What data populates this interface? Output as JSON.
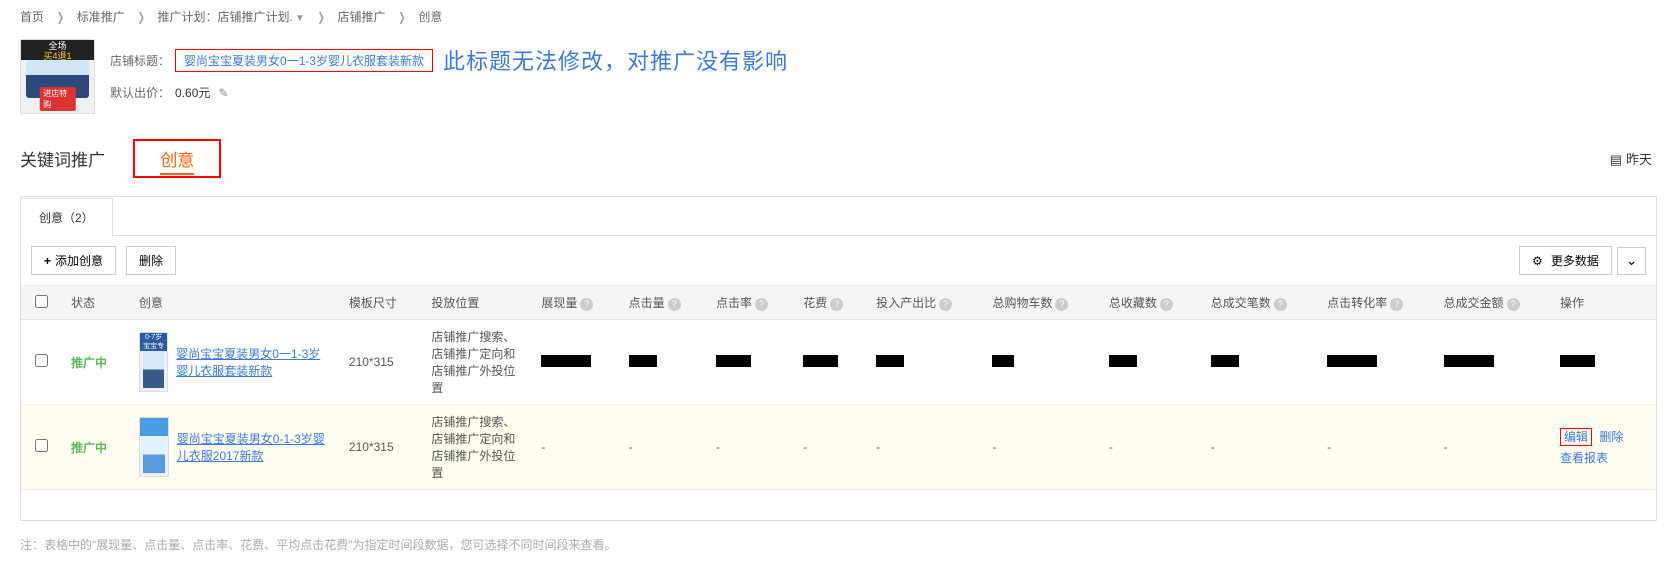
{
  "breadcrumb": {
    "home": "首页",
    "std": "标准推广",
    "plan_prefix": "推广计划：",
    "plan_name": "店铺推广计划.",
    "shop": "店铺推广",
    "creative": "创意"
  },
  "header": {
    "title_label": "店铺标题：",
    "title_value": "婴尚宝宝夏装男女0一1-3岁婴儿衣服套装新款",
    "blue_note": "此标题无法修改，对推广没有影响",
    "bid_label": "默认出价：",
    "bid_value": "0.60元",
    "thumb_badge_line1": "全场",
    "thumb_badge_line2": "买4退1",
    "thumb_btn": "进店特购"
  },
  "section": {
    "keyword_tab": "关键词推广",
    "creative_tab": "创意",
    "date": "昨天"
  },
  "card": {
    "tab": "创意（2）",
    "add_btn": "添加创意",
    "del_btn": "删除",
    "more_data_btn": "更多数据"
  },
  "columns": {
    "c1": "状态",
    "c2": "创意",
    "c3": "模板尺寸",
    "c4": "投放位置",
    "c5": "展现量",
    "c6": "点击量",
    "c7": "点击率",
    "c8": "花费",
    "c9": "投入产出比",
    "c10": "总购物车数",
    "c11": "总收藏数",
    "c12": "总成交笔数",
    "c13": "点击转化率",
    "c14": "总成交金额",
    "c15": "操作"
  },
  "rows": [
    {
      "status": "推广中",
      "title": "婴尚宝宝夏装男女0一1-3岁婴儿衣服套装新款",
      "size": "210*315",
      "pos": "店铺推广搜索、店铺推广定向和店铺推广外投位置",
      "thumb_label_l1": "0-7岁",
      "thumb_label_l2": "宝宝专场"
    },
    {
      "status": "推广中",
      "title": "婴尚宝宝夏装男女0-1-3岁婴儿衣服2017新款",
      "size": "210*315",
      "pos": "店铺推广搜索、店铺推广定向和店铺推广外投位置",
      "thumb_label_l1": "",
      "thumb_label_l2": ""
    }
  ],
  "ops": {
    "edit": "编辑",
    "del": "删除",
    "report": "查看报表"
  },
  "dash": "-",
  "footnote": "注：表格中的\"展现量、点击量、点击率、花费、平均点击花费\"为指定时间段数据，您可选择不同时间段来查看。"
}
